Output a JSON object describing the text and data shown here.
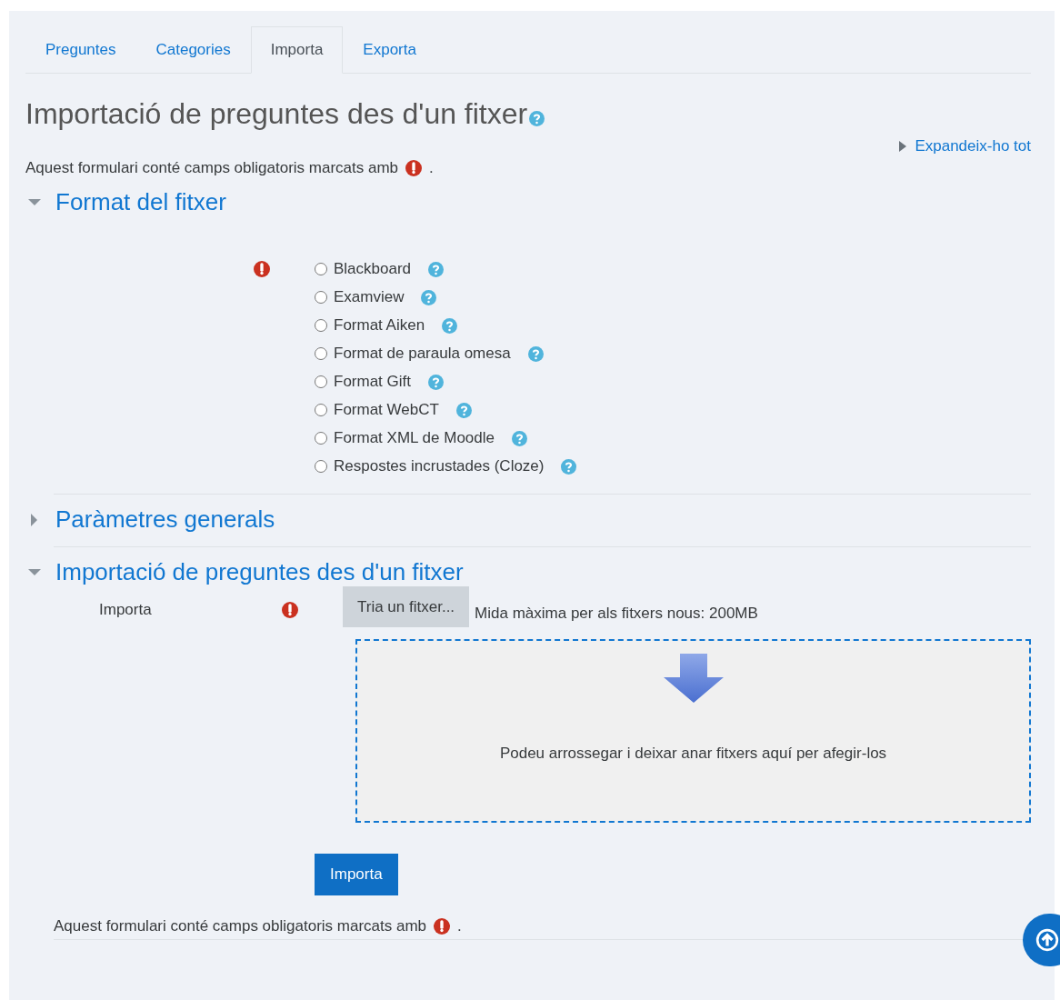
{
  "tabs": [
    {
      "label": "Preguntes",
      "selected": false
    },
    {
      "label": "Categories",
      "selected": false
    },
    {
      "label": "Importa",
      "selected": true
    },
    {
      "label": "Exporta",
      "selected": false
    }
  ],
  "title": "Importació de preguntes des d'un fitxer",
  "expand_all": "Expandeix-ho tot",
  "required_note": {
    "text": "Aquest formulari conté camps obligatoris marcats amb",
    "end": "."
  },
  "sections": [
    {
      "kind": "formats",
      "title": "Format del fitxer",
      "expanded": true,
      "required": true,
      "options": [
        {
          "label": "Blackboard",
          "selected": false
        },
        {
          "label": "Examview",
          "selected": false
        },
        {
          "label": "Format Aiken",
          "selected": false
        },
        {
          "label": "Format de paraula omesa",
          "selected": false
        },
        {
          "label": "Format Gift",
          "selected": false
        },
        {
          "label": "Format WebCT",
          "selected": false
        },
        {
          "label": "Format XML de Moodle",
          "selected": false
        },
        {
          "label": "Respostes incrustades (Cloze)",
          "selected": false
        }
      ]
    },
    {
      "title": "Paràmetres generals",
      "expanded": false
    },
    {
      "kind": "file",
      "title": "Importació de preguntes des d'un fitxer",
      "expanded": true,
      "required": true,
      "field_label": "Importa",
      "choose_button": "Tria un fitxer...",
      "max_size": "Mida màxima per als fitxers nous: 200MB",
      "drop_text": "Podeu arrossegar i deixar anar fitxers aquí per afegir-los"
    }
  ],
  "submit": "Importa",
  "footer_note": {
    "text": "Aquest formulari conté camps obligatoris marcats amb",
    "end": "."
  }
}
